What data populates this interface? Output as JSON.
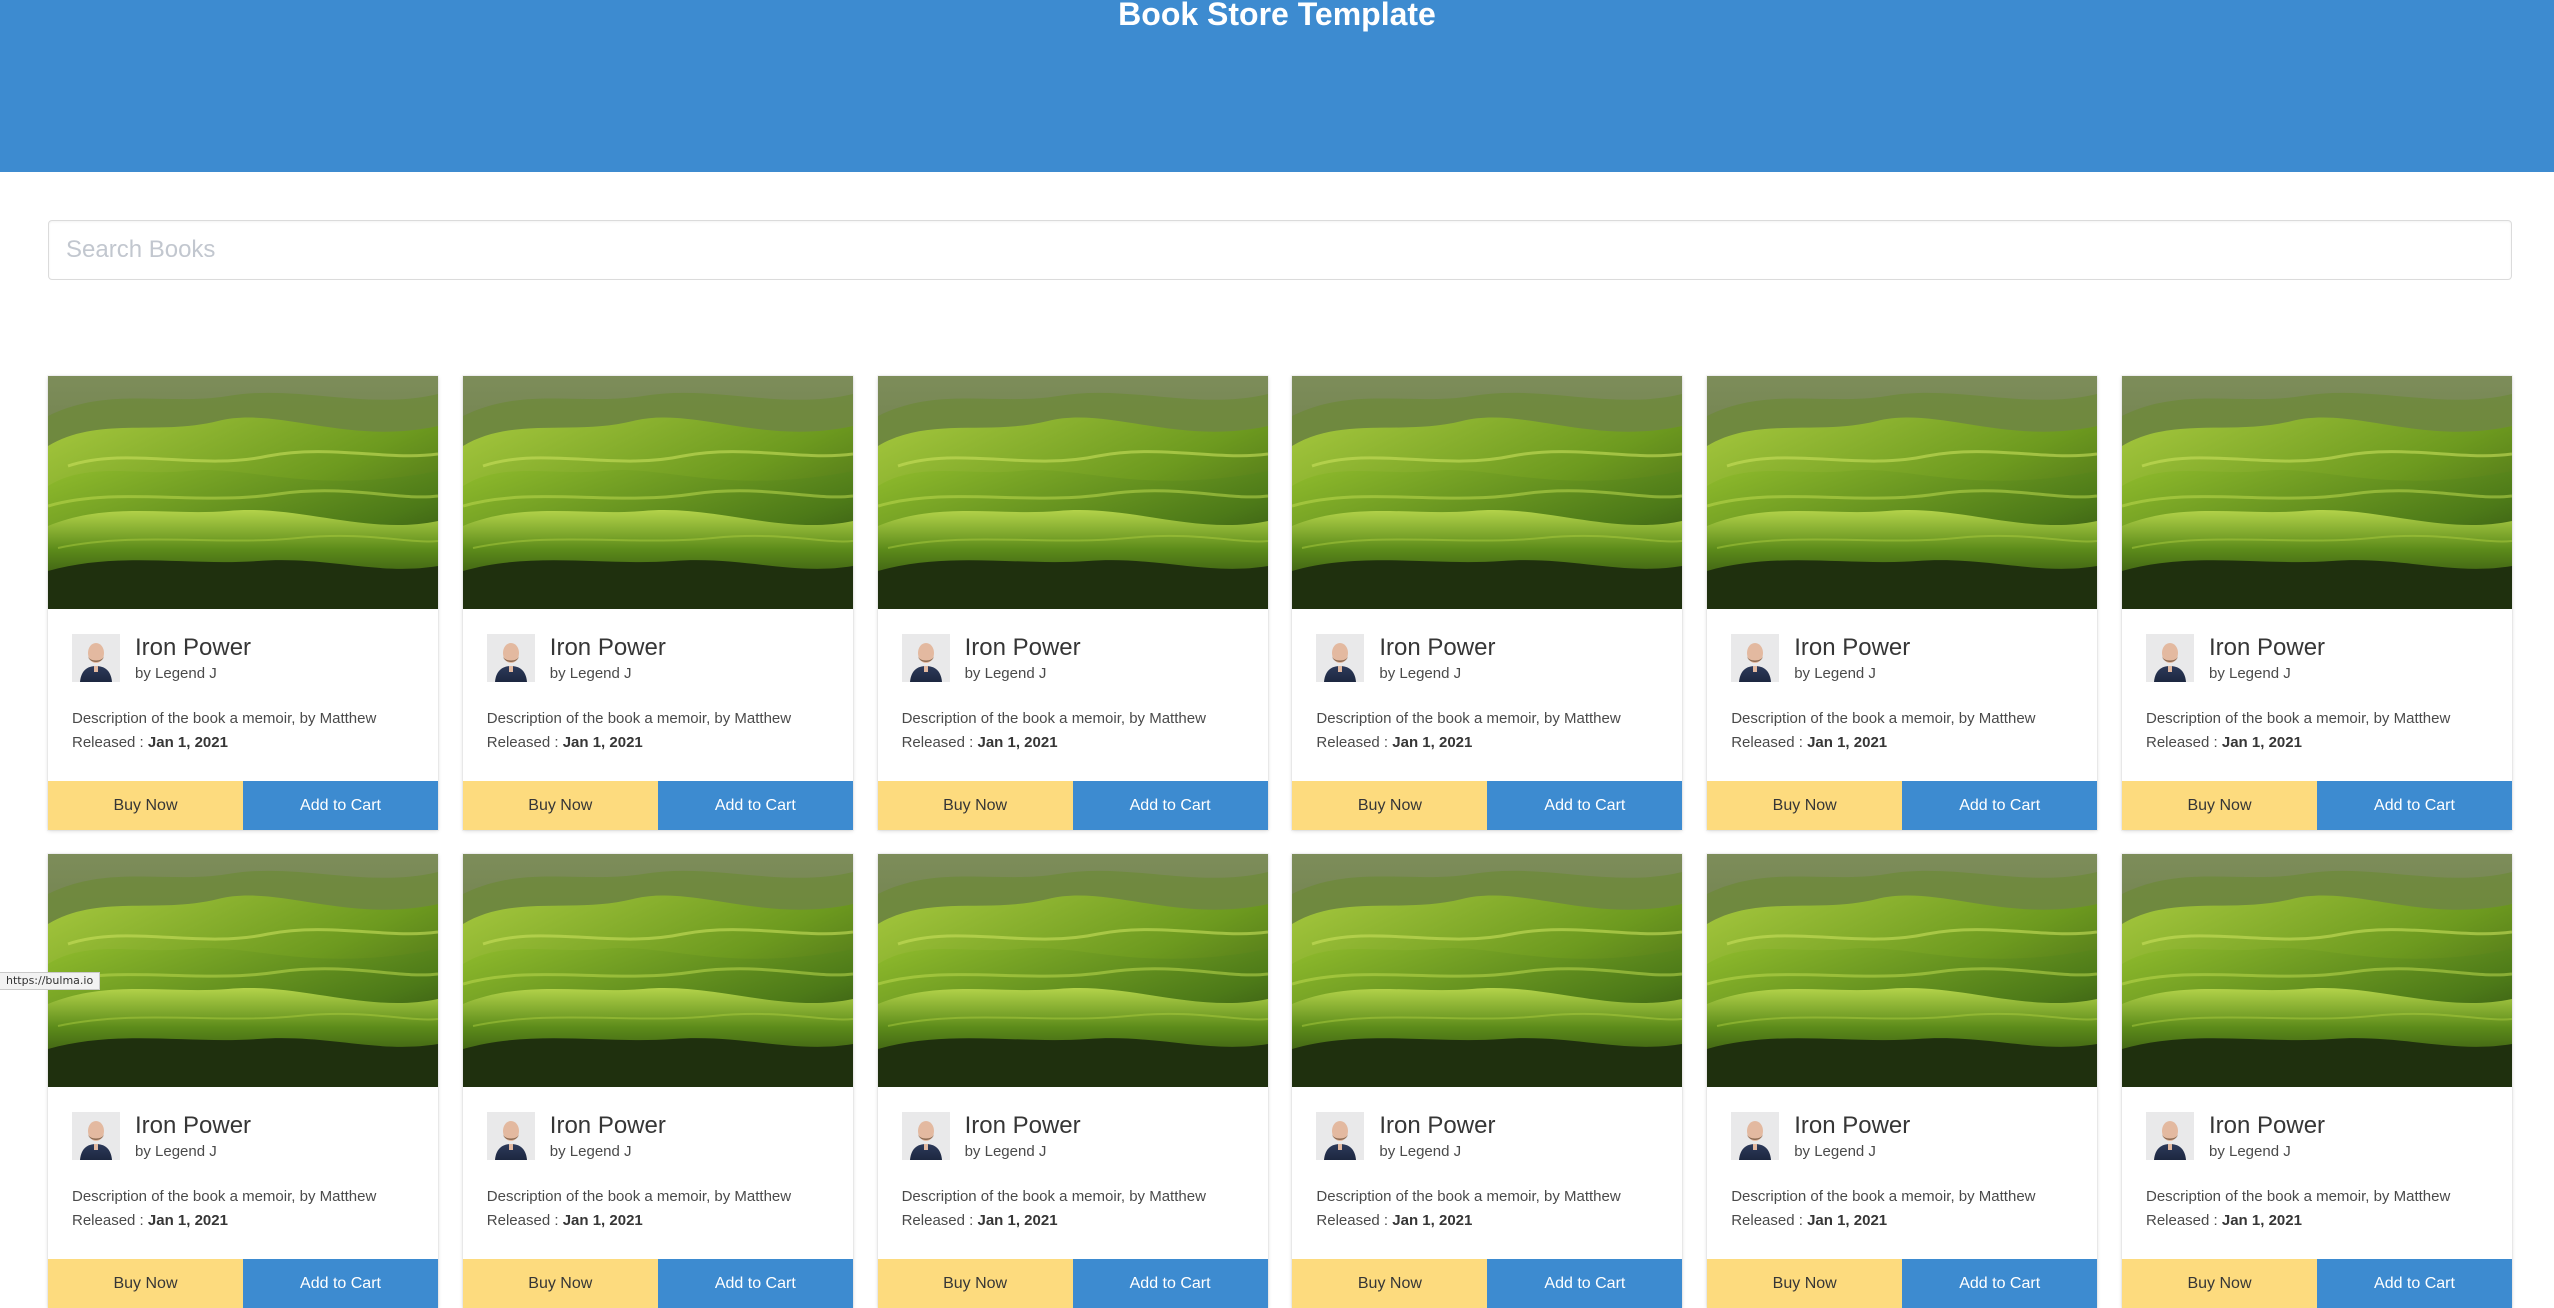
{
  "hero": {
    "title": "Book Store Template"
  },
  "search": {
    "placeholder": "Search Books",
    "value": ""
  },
  "cards": [
    {
      "title": "Iron Power",
      "author": "by Legend J",
      "description": "Description of the book a memoir, by Matthew",
      "released_label": "Released :",
      "released_date": "Jan 1, 2021",
      "buy_label": "Buy Now",
      "cart_label": "Add to Cart"
    },
    {
      "title": "Iron Power",
      "author": "by Legend J",
      "description": "Description of the book a memoir, by Matthew",
      "released_label": "Released :",
      "released_date": "Jan 1, 2021",
      "buy_label": "Buy Now",
      "cart_label": "Add to Cart"
    },
    {
      "title": "Iron Power",
      "author": "by Legend J",
      "description": "Description of the book a memoir, by Matthew",
      "released_label": "Released :",
      "released_date": "Jan 1, 2021",
      "buy_label": "Buy Now",
      "cart_label": "Add to Cart"
    },
    {
      "title": "Iron Power",
      "author": "by Legend J",
      "description": "Description of the book a memoir, by Matthew",
      "released_label": "Released :",
      "released_date": "Jan 1, 2021",
      "buy_label": "Buy Now",
      "cart_label": "Add to Cart"
    },
    {
      "title": "Iron Power",
      "author": "by Legend J",
      "description": "Description of the book a memoir, by Matthew",
      "released_label": "Released :",
      "released_date": "Jan 1, 2021",
      "buy_label": "Buy Now",
      "cart_label": "Add to Cart"
    },
    {
      "title": "Iron Power",
      "author": "by Legend J",
      "description": "Description of the book a memoir, by Matthew",
      "released_label": "Released :",
      "released_date": "Jan 1, 2021",
      "buy_label": "Buy Now",
      "cart_label": "Add to Cart"
    },
    {
      "title": "Iron Power",
      "author": "by Legend J",
      "description": "Description of the book a memoir, by Matthew",
      "released_label": "Released :",
      "released_date": "Jan 1, 2021",
      "buy_label": "Buy Now",
      "cart_label": "Add to Cart"
    },
    {
      "title": "Iron Power",
      "author": "by Legend J",
      "description": "Description of the book a memoir, by Matthew",
      "released_label": "Released :",
      "released_date": "Jan 1, 2021",
      "buy_label": "Buy Now",
      "cart_label": "Add to Cart"
    },
    {
      "title": "Iron Power",
      "author": "by Legend J",
      "description": "Description of the book a memoir, by Matthew",
      "released_label": "Released :",
      "released_date": "Jan 1, 2021",
      "buy_label": "Buy Now",
      "cart_label": "Add to Cart"
    },
    {
      "title": "Iron Power",
      "author": "by Legend J",
      "description": "Description of the book a memoir, by Matthew",
      "released_label": "Released :",
      "released_date": "Jan 1, 2021",
      "buy_label": "Buy Now",
      "cart_label": "Add to Cart"
    },
    {
      "title": "Iron Power",
      "author": "by Legend J",
      "description": "Description of the book a memoir, by Matthew",
      "released_label": "Released :",
      "released_date": "Jan 1, 2021",
      "buy_label": "Buy Now",
      "cart_label": "Add to Cart"
    },
    {
      "title": "Iron Power",
      "author": "by Legend J",
      "description": "Description of the book a memoir, by Matthew",
      "released_label": "Released :",
      "released_date": "Jan 1, 2021",
      "buy_label": "Buy Now",
      "cart_label": "Add to Cart"
    }
  ],
  "status_bar": {
    "url": "https://bulma.io"
  },
  "colors": {
    "primary": "#3d8bd0",
    "buy_button": "#fddb7e",
    "cart_button": "#3d8bd0",
    "hero_text": "#ffffff"
  }
}
